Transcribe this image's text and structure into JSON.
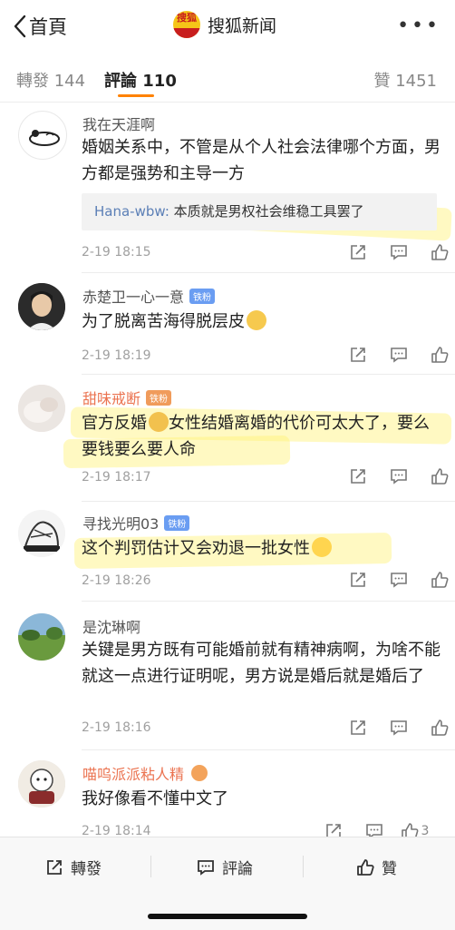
{
  "nav": {
    "back_label": "首頁",
    "brand_logo_text": "搜狐",
    "title": "搜狐新闻",
    "more": "•••"
  },
  "tabs": {
    "repost": "轉發 144",
    "comment": "評論 110",
    "like": "贊 1451"
  },
  "comments": [
    {
      "name": "我在天涯啊",
      "badge": "",
      "text": "婚姻关系中，不管是从个人社会法律哪个方面，男方都是强势和主导一方",
      "reply_name": "Hana-wbw:",
      "reply_text": " 本质就是男权社会维稳工具罢了",
      "time": "2-19 18:15",
      "likes": ""
    },
    {
      "name": "赤楚卫一心一意",
      "badge": "铁粉",
      "text": "为了脱离苦海得脱层皮",
      "time": "2-19 18:19",
      "likes": ""
    },
    {
      "name": "甜味戒断",
      "badge": "铁粉",
      "text_a": "官方反婚",
      "text_b": "女性结婚离婚的代价可太大了，要么要钱要么要人命",
      "time": "2-19 18:17",
      "likes": ""
    },
    {
      "name": "寻找光明03",
      "badge": "铁粉",
      "text": "这个判罚估计又会劝退一批女性",
      "time": "2-19 18:26",
      "likes": ""
    },
    {
      "name": "是沈琳啊",
      "badge": "",
      "text": "关键是男方既有可能婚前就有精神病啊，为啥不能就这一点进行证明呢，男方说是婚后就是婚后了",
      "time": "2-19 18:16",
      "likes": ""
    },
    {
      "name": "喵呜派派粘人精",
      "badge": "",
      "text": "我好像看不懂中文了",
      "time": "2-19 18:14",
      "likes": "3"
    }
  ],
  "bottom": {
    "repost": "轉發",
    "comment": "評論",
    "like": "贊"
  },
  "colors": {
    "accent": "#ff8200",
    "name_orange": "#eb7350",
    "reply_blue": "#5b7fb6",
    "fan_badge": "#6a9df2"
  }
}
